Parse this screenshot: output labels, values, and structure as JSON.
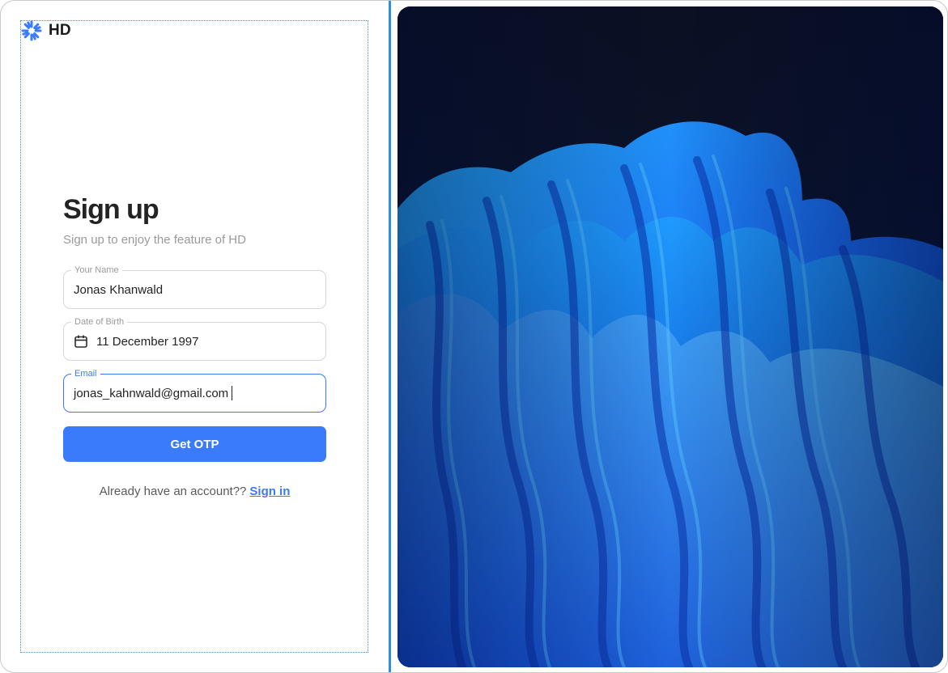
{
  "brand": {
    "name": "HD"
  },
  "signup": {
    "title": "Sign up",
    "subtitle": "Sign up to enjoy the feature of HD",
    "fields": {
      "name": {
        "label": "Your Name",
        "value": "Jonas Khanwald"
      },
      "dob": {
        "label": "Date of Birth",
        "value": "11 December 1997"
      },
      "email": {
        "label": "Email",
        "value": "jonas_kahnwald@gmail.com"
      }
    },
    "submit_label": "Get OTP",
    "signin_prompt": "Already have an account??",
    "signin_link": "Sign in"
  },
  "colors": {
    "accent": "#3a7bfb",
    "divider": "#2f8ee0",
    "hero_background": "#0b1124",
    "hero_wave": "#1a6ef5"
  },
  "icons": {
    "brand": "sunburst-icon",
    "date": "calendar-icon"
  }
}
